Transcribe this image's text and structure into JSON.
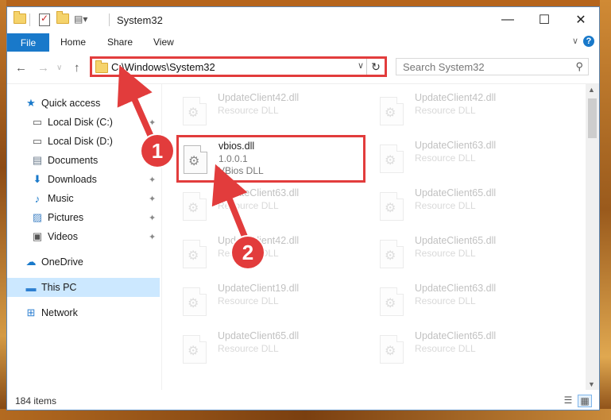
{
  "window": {
    "title": "System32",
    "controls": {
      "minimize": "—",
      "maximize": "☐",
      "close": "✕"
    }
  },
  "ribbon": {
    "tabs": [
      "File",
      "Home",
      "Share",
      "View"
    ],
    "help": "?",
    "collapse": "∨"
  },
  "navigation": {
    "back": "←",
    "forward": "→",
    "up": "↑",
    "recent": "∨",
    "address": "C:\\Windows\\System32",
    "address_dropdown": "∨",
    "refresh": "↻",
    "search_placeholder": "Search System32",
    "search_icon": "⚲"
  },
  "sidebar": {
    "items": [
      {
        "label": "Quick access",
        "icon": "star-icon",
        "glyph": "★",
        "color": "#1979ca",
        "pinned": false
      },
      {
        "label": "Local Disk (C:)",
        "icon": "drive-icon",
        "glyph": "▭",
        "color": "#555555",
        "pinned": true
      },
      {
        "label": "Local Disk (D:)",
        "icon": "drive-icon",
        "glyph": "▭",
        "color": "#555555",
        "pinned": false
      },
      {
        "label": "Documents",
        "icon": "documents-icon",
        "glyph": "▤",
        "color": "#6b7b8c",
        "pinned": true
      },
      {
        "label": "Downloads",
        "icon": "download-icon",
        "glyph": "⬇",
        "color": "#1979ca",
        "pinned": true
      },
      {
        "label": "Music",
        "icon": "music-icon",
        "glyph": "♪",
        "color": "#1979ca",
        "pinned": true
      },
      {
        "label": "Pictures",
        "icon": "pictures-icon",
        "glyph": "▨",
        "color": "#4a88c7",
        "pinned": true
      },
      {
        "label": "Videos",
        "icon": "videos-icon",
        "glyph": "▣",
        "color": "#555555",
        "pinned": true
      },
      {
        "label": "OneDrive",
        "icon": "cloud-icon",
        "glyph": "☁",
        "color": "#1979ca",
        "pinned": false
      },
      {
        "label": "This PC",
        "icon": "computer-icon",
        "glyph": "▬",
        "color": "#2d7fd1",
        "pinned": false
      },
      {
        "label": "Network",
        "icon": "network-icon",
        "glyph": "⊞",
        "color": "#2d7fd1",
        "pinned": false
      }
    ],
    "pin_glyph": "📌"
  },
  "files": {
    "left_column": [
      {
        "name": "UpdateClient42.dll",
        "type": "Resource DLL",
        "faded": true
      },
      {
        "name": "vbios.dll",
        "version": "1.0.0.1",
        "type": "VBios DLL",
        "faded": false,
        "highlighted": true
      },
      {
        "name": "UpdateClient63.dll",
        "type": "Resource DLL",
        "faded": true
      },
      {
        "name": "UpdateClient42.dll",
        "type": "Resource DLL",
        "faded": true
      },
      {
        "name": "UpdateClient19.dll",
        "type": "Resource DLL",
        "faded": true
      },
      {
        "name": "UpdateClient65.dll",
        "type": "Resource DLL",
        "faded": true
      }
    ],
    "right_column": [
      {
        "name": "UpdateClient42.dll",
        "type": "Resource DLL",
        "faded": true
      },
      {
        "name": "UpdateClient63.dll",
        "type": "Resource DLL",
        "faded": true
      },
      {
        "name": "UpdateClient65.dll",
        "type": "Resource DLL",
        "faded": true
      },
      {
        "name": "UpdateClient65.dll",
        "type": "Resource DLL",
        "faded": true
      },
      {
        "name": "UpdateClient63.dll",
        "type": "Resource DLL",
        "faded": true
      },
      {
        "name": "UpdateClient65.dll",
        "type": "Resource DLL",
        "faded": true
      }
    ]
  },
  "status": {
    "item_count": "184 items"
  },
  "annotations": {
    "step1": "1",
    "step2": "2",
    "accent_color": "#e23c3c"
  },
  "colors": {
    "file_tab": "#1979ca",
    "selected_nav": "#cce8ff"
  }
}
